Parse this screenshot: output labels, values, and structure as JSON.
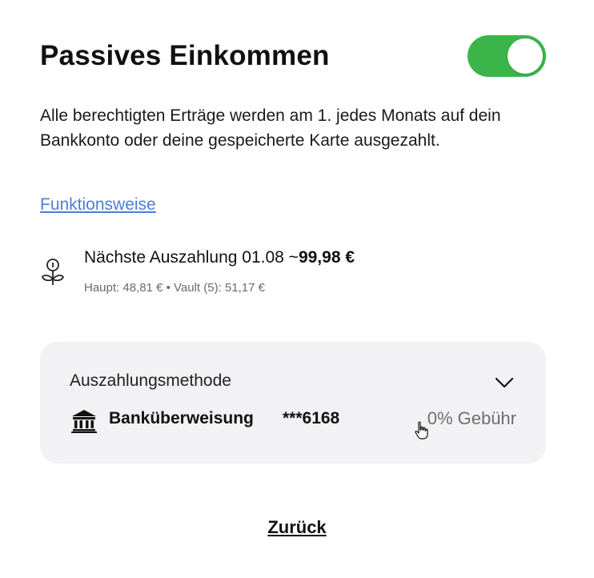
{
  "header": {
    "title": "Passives Einkommen",
    "toggle_on": true
  },
  "description": "Alle berechtigten Erträge werden am 1. jedes Monats auf dein Bankkonto oder deine gespeicherte Karte ausgezahlt.",
  "how_it_works_link": "Funktionsweise",
  "next_payout": {
    "icon": "sprout-coin-icon",
    "label": "Nächste Auszahlung 01.08 ~",
    "amount": "99,98 €",
    "breakdown": "Haupt: 48,81 € • Vault (5): 51,17 €"
  },
  "payout_method": {
    "label": "Auszahlungsmethode",
    "method_icon": "bank-icon",
    "method_name": "Banküberweisung",
    "account_masked": "***6168",
    "fee": "0% Gebühr"
  },
  "back_button": "Zurück",
  "colors": {
    "toggle_on": "#3bb54a",
    "link": "#4a7fd8",
    "card_bg": "#f2f2f4",
    "muted_text": "#6b6b6b"
  }
}
